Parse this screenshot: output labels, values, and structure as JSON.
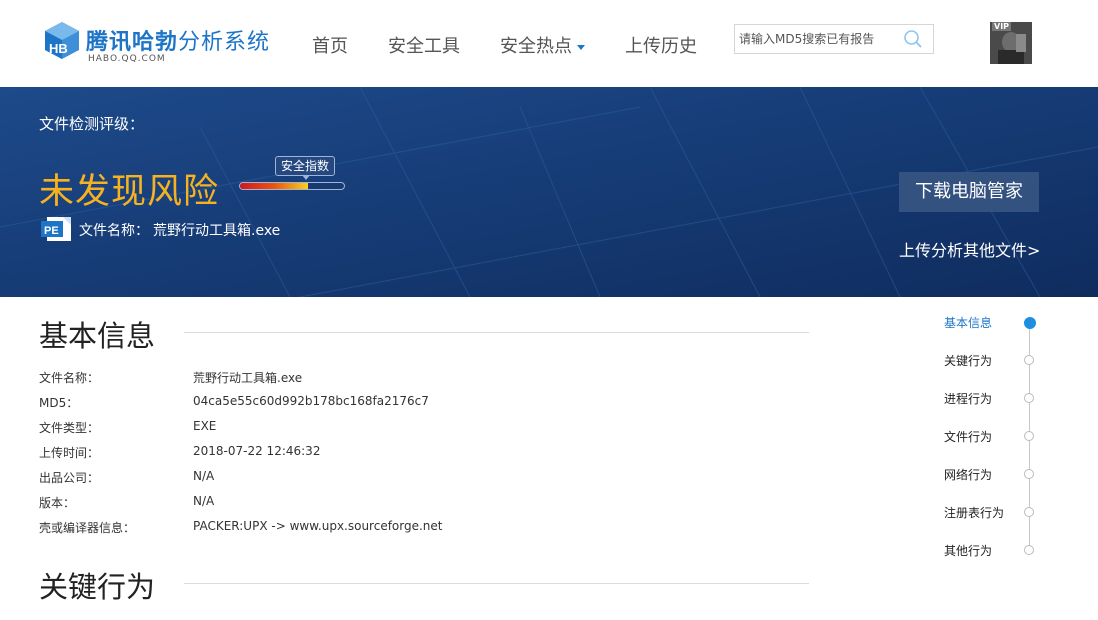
{
  "brand": {
    "title_bold": "腾讯哈勃",
    "title_rest": "分析系统",
    "sub": "HABO.QQ.COM"
  },
  "nav": [
    {
      "label": "首页"
    },
    {
      "label": "安全工具"
    },
    {
      "label": "安全热点"
    },
    {
      "label": "上传历史"
    }
  ],
  "search": {
    "placeholder": "请输入MD5搜索已有报告",
    "value": ""
  },
  "avatar": {
    "badge": "VIP"
  },
  "banner": {
    "rating_label": "文件检测评级：",
    "risk": "未发现风险",
    "tooltip": "安全指数",
    "safety_index": 0.65,
    "file_icon": "PE",
    "file_name_label": "文件名称：",
    "file_name": "荒野行动工具箱.exe",
    "download_button": "下载电脑管家",
    "upload_link": "上传分析其他文件>"
  },
  "basic": {
    "title": "基本信息",
    "rows": [
      {
        "key": "文件名称：",
        "value": "荒野行动工具箱.exe"
      },
      {
        "key": "MD5：",
        "value": "04ca5e55c60d992b178bc168fa2176c7"
      },
      {
        "key": "文件类型：",
        "value": "EXE"
      },
      {
        "key": "上传时间：",
        "value": "2018-07-22 12:46:32"
      },
      {
        "key": "出品公司：",
        "value": "N/A"
      },
      {
        "key": "版本：",
        "value": "N/A"
      },
      {
        "key": "壳或编译器信息：",
        "value": "PACKER:UPX -> www.upx.sourceforge.net"
      }
    ]
  },
  "key_behavior": {
    "title": "关键行为"
  },
  "rail": [
    {
      "label": "基本信息",
      "active": true
    },
    {
      "label": "关键行为"
    },
    {
      "label": "进程行为"
    },
    {
      "label": "文件行为"
    },
    {
      "label": "网络行为"
    },
    {
      "label": "注册表行为"
    },
    {
      "label": "其他行为"
    }
  ],
  "colors": {
    "brand_blue": "#1e75c8",
    "banner_bg": "#173a72",
    "risk_orange": "#f7b21f"
  }
}
